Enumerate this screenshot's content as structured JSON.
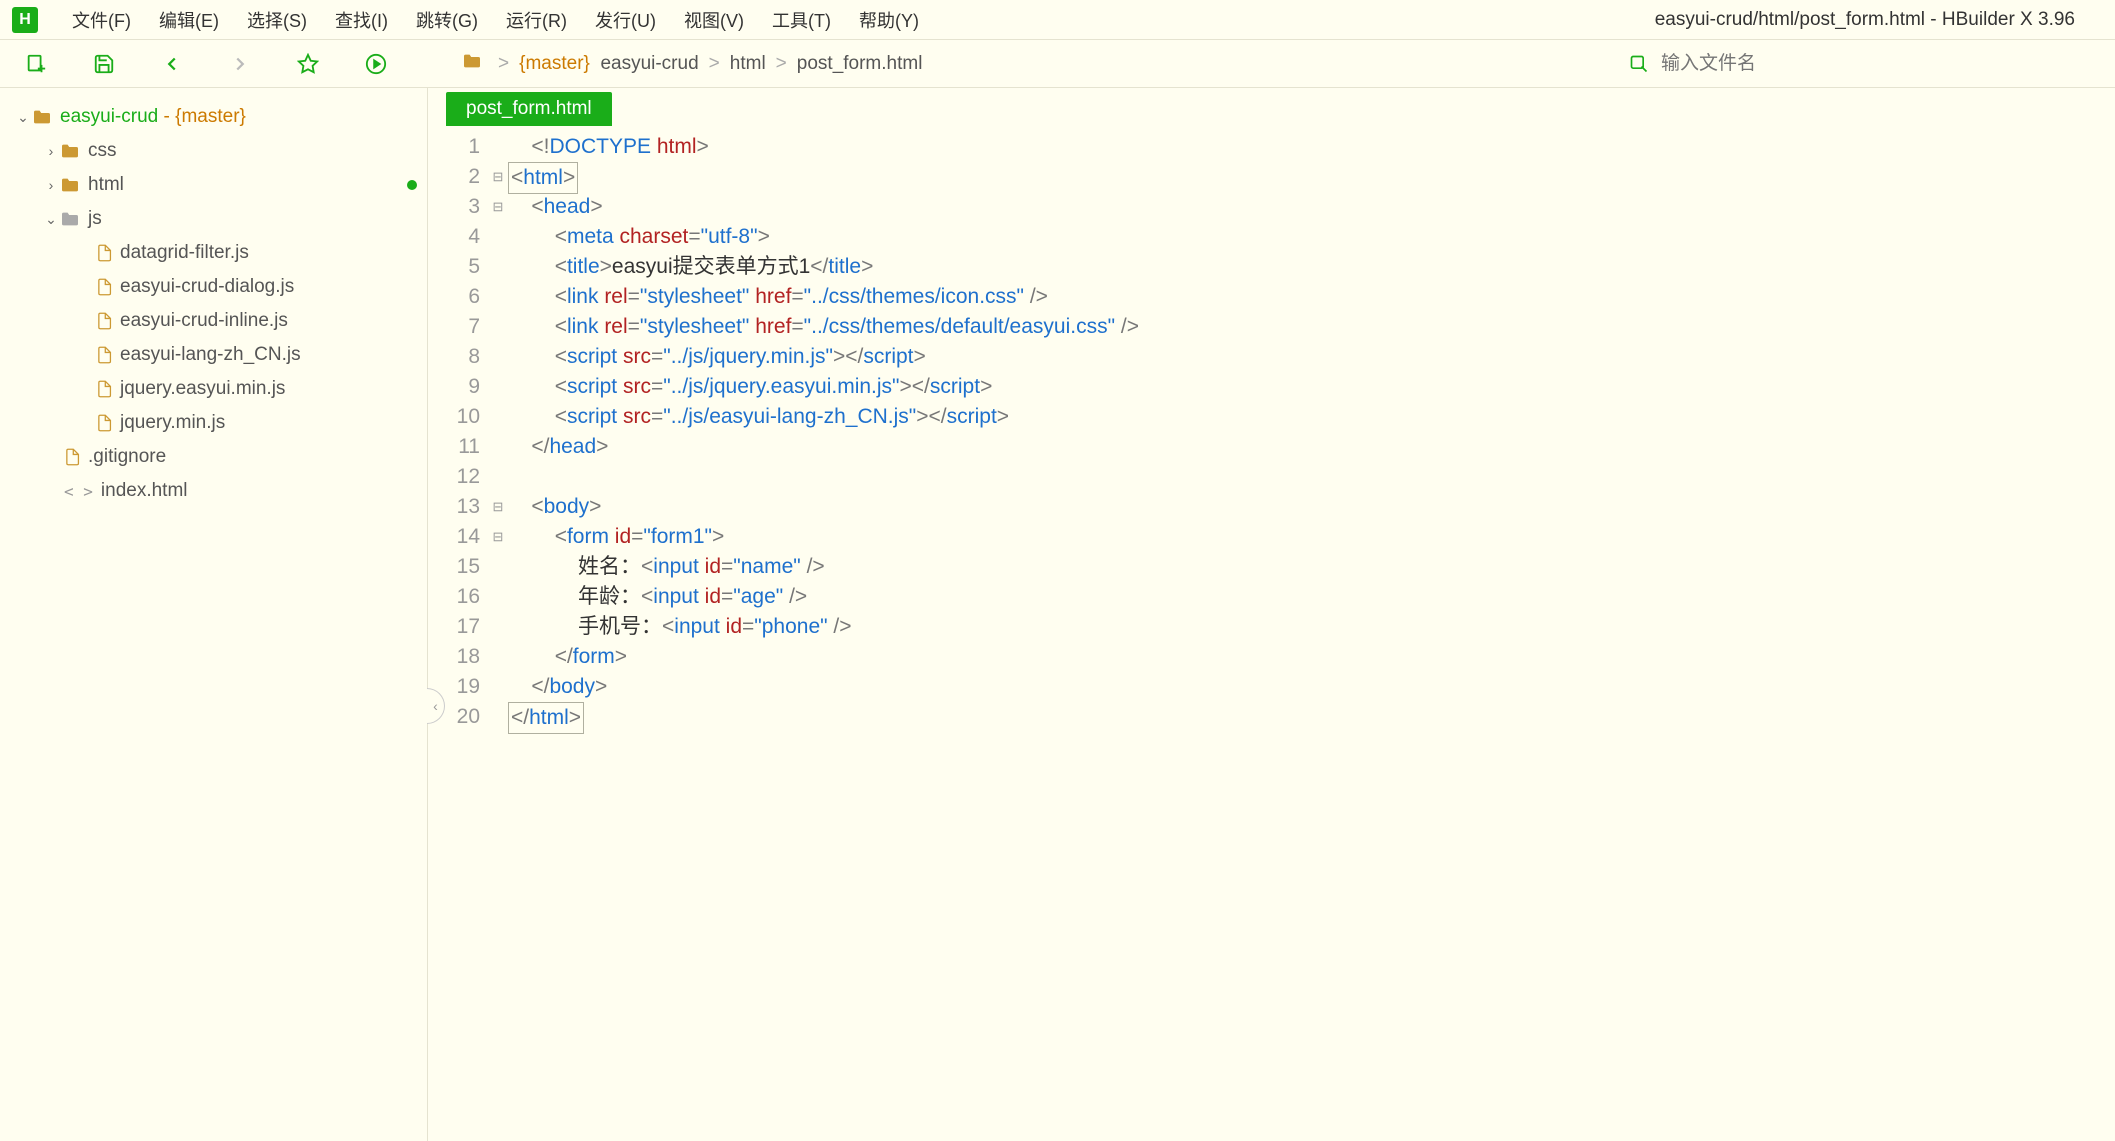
{
  "app": {
    "logo": "H",
    "title": "easyui-crud/html/post_form.html - HBuilder X 3.96"
  },
  "menu": [
    "文件(F)",
    "编辑(E)",
    "选择(S)",
    "查找(I)",
    "跳转(G)",
    "运行(R)",
    "发行(U)",
    "视图(V)",
    "工具(T)",
    "帮助(Y)"
  ],
  "breadcrumb": {
    "branch": "{master}",
    "parts": [
      "easyui-crud",
      "html",
      "post_form.html"
    ]
  },
  "search": {
    "placeholder": "输入文件名"
  },
  "sidebar": {
    "root": {
      "name": "easyui-crud",
      "branch": "- {master}"
    },
    "folders": [
      {
        "name": "css",
        "expanded": false
      },
      {
        "name": "html",
        "expanded": false,
        "modified": true
      },
      {
        "name": "js",
        "expanded": true,
        "files": [
          "datagrid-filter.js",
          "easyui-crud-dialog.js",
          "easyui-crud-inline.js",
          "easyui-lang-zh_CN.js",
          "jquery.easyui.min.js",
          "jquery.min.js"
        ]
      }
    ],
    "rootFiles": [
      {
        "name": ".gitignore",
        "type": "gitignore"
      },
      {
        "name": "index.html",
        "type": "html"
      }
    ]
  },
  "tab": {
    "label": "post_form.html"
  },
  "code": {
    "lines": [
      {
        "n": 1,
        "fold": "",
        "indent": 1,
        "tokens": [
          [
            "pun",
            "<!"
          ],
          [
            "tag",
            "DOCTYPE "
          ],
          [
            "tagname",
            "html"
          ],
          [
            "pun",
            ">"
          ]
        ]
      },
      {
        "n": 2,
        "fold": "⊟",
        "indent": 0,
        "box": true,
        "tokens": [
          [
            "pun",
            "<"
          ],
          [
            "tag",
            "html"
          ],
          [
            "pun",
            ">"
          ]
        ]
      },
      {
        "n": 3,
        "fold": "⊟",
        "indent": 1,
        "tokens": [
          [
            "pun",
            "<"
          ],
          [
            "tag",
            "head"
          ],
          [
            "pun",
            ">"
          ]
        ]
      },
      {
        "n": 4,
        "fold": "",
        "indent": 2,
        "tokens": [
          [
            "pun",
            "<"
          ],
          [
            "tag",
            "meta "
          ],
          [
            "attr",
            "charset"
          ],
          [
            "pun",
            "="
          ],
          [
            "str",
            "\"utf-8\""
          ],
          [
            "pun",
            ">"
          ]
        ]
      },
      {
        "n": 5,
        "fold": "",
        "indent": 2,
        "tokens": [
          [
            "pun",
            "<"
          ],
          [
            "tag",
            "title"
          ],
          [
            "pun",
            ">"
          ],
          [
            "txt",
            "easyui提交表单方式1"
          ],
          [
            "pun",
            "</"
          ],
          [
            "tag",
            "title"
          ],
          [
            "pun",
            ">"
          ]
        ]
      },
      {
        "n": 6,
        "fold": "",
        "indent": 2,
        "tokens": [
          [
            "pun",
            "<"
          ],
          [
            "tag",
            "link "
          ],
          [
            "attr",
            "rel"
          ],
          [
            "pun",
            "="
          ],
          [
            "str",
            "\"stylesheet\" "
          ],
          [
            "attr",
            "href"
          ],
          [
            "pun",
            "="
          ],
          [
            "str",
            "\"../css/themes/icon.css\""
          ],
          [
            "pun",
            " />"
          ]
        ]
      },
      {
        "n": 7,
        "fold": "",
        "indent": 2,
        "tokens": [
          [
            "pun",
            "<"
          ],
          [
            "tag",
            "link "
          ],
          [
            "attr",
            "rel"
          ],
          [
            "pun",
            "="
          ],
          [
            "str",
            "\"stylesheet\" "
          ],
          [
            "attr",
            "href"
          ],
          [
            "pun",
            "="
          ],
          [
            "str",
            "\"../css/themes/default/easyui.css\""
          ],
          [
            "pun",
            " />"
          ]
        ]
      },
      {
        "n": 8,
        "fold": "",
        "indent": 2,
        "tokens": [
          [
            "pun",
            "<"
          ],
          [
            "tag",
            "script "
          ],
          [
            "attr",
            "src"
          ],
          [
            "pun",
            "="
          ],
          [
            "str",
            "\"../js/jquery.min.js\""
          ],
          [
            "pun",
            "></"
          ],
          [
            "tag",
            "script"
          ],
          [
            "pun",
            ">"
          ]
        ]
      },
      {
        "n": 9,
        "fold": "",
        "indent": 2,
        "tokens": [
          [
            "pun",
            "<"
          ],
          [
            "tag",
            "script "
          ],
          [
            "attr",
            "src"
          ],
          [
            "pun",
            "="
          ],
          [
            "str",
            "\"../js/jquery.easyui.min.js\""
          ],
          [
            "pun",
            "></"
          ],
          [
            "tag",
            "script"
          ],
          [
            "pun",
            ">"
          ]
        ]
      },
      {
        "n": 10,
        "fold": "",
        "indent": 2,
        "tokens": [
          [
            "pun",
            "<"
          ],
          [
            "tag",
            "script "
          ],
          [
            "attr",
            "src"
          ],
          [
            "pun",
            "="
          ],
          [
            "str",
            "\"../js/easyui-lang-zh_CN.js\""
          ],
          [
            "pun",
            "></"
          ],
          [
            "tag",
            "script"
          ],
          [
            "pun",
            ">"
          ]
        ]
      },
      {
        "n": 11,
        "fold": "",
        "indent": 1,
        "tokens": [
          [
            "pun",
            "</"
          ],
          [
            "tag",
            "head"
          ],
          [
            "pun",
            ">"
          ]
        ]
      },
      {
        "n": 12,
        "fold": "",
        "indent": 0,
        "tokens": []
      },
      {
        "n": 13,
        "fold": "⊟",
        "indent": 1,
        "tokens": [
          [
            "pun",
            "<"
          ],
          [
            "tag",
            "body"
          ],
          [
            "pun",
            ">"
          ]
        ]
      },
      {
        "n": 14,
        "fold": "⊟",
        "indent": 2,
        "tokens": [
          [
            "pun",
            "<"
          ],
          [
            "tag",
            "form "
          ],
          [
            "attr",
            "id"
          ],
          [
            "pun",
            "="
          ],
          [
            "str",
            "\"form1\""
          ],
          [
            "pun",
            ">"
          ]
        ]
      },
      {
        "n": 15,
        "fold": "",
        "indent": 3,
        "tokens": [
          [
            "txt",
            "姓名："
          ],
          [
            "pun",
            "<"
          ],
          [
            "tag",
            "input "
          ],
          [
            "attr",
            "id"
          ],
          [
            "pun",
            "="
          ],
          [
            "str",
            "\"name\""
          ],
          [
            "pun",
            " />"
          ]
        ]
      },
      {
        "n": 16,
        "fold": "",
        "indent": 3,
        "tokens": [
          [
            "txt",
            "年龄："
          ],
          [
            "pun",
            "<"
          ],
          [
            "tag",
            "input "
          ],
          [
            "attr",
            "id"
          ],
          [
            "pun",
            "="
          ],
          [
            "str",
            "\"age\""
          ],
          [
            "pun",
            " />"
          ]
        ]
      },
      {
        "n": 17,
        "fold": "",
        "indent": 3,
        "tokens": [
          [
            "txt",
            "手机号："
          ],
          [
            "pun",
            "<"
          ],
          [
            "tag",
            "input "
          ],
          [
            "attr",
            "id"
          ],
          [
            "pun",
            "="
          ],
          [
            "str",
            "\"phone\""
          ],
          [
            "pun",
            " />"
          ]
        ]
      },
      {
        "n": 18,
        "fold": "",
        "indent": 2,
        "tokens": [
          [
            "pun",
            "</"
          ],
          [
            "tag",
            "form"
          ],
          [
            "pun",
            ">"
          ]
        ]
      },
      {
        "n": 19,
        "fold": "",
        "indent": 1,
        "tokens": [
          [
            "pun",
            "</"
          ],
          [
            "tag",
            "body"
          ],
          [
            "pun",
            ">"
          ]
        ]
      },
      {
        "n": 20,
        "fold": "",
        "indent": 0,
        "box": true,
        "tokens": [
          [
            "pun",
            "</"
          ],
          [
            "tag",
            "html"
          ],
          [
            "pun",
            ">"
          ]
        ]
      }
    ]
  }
}
